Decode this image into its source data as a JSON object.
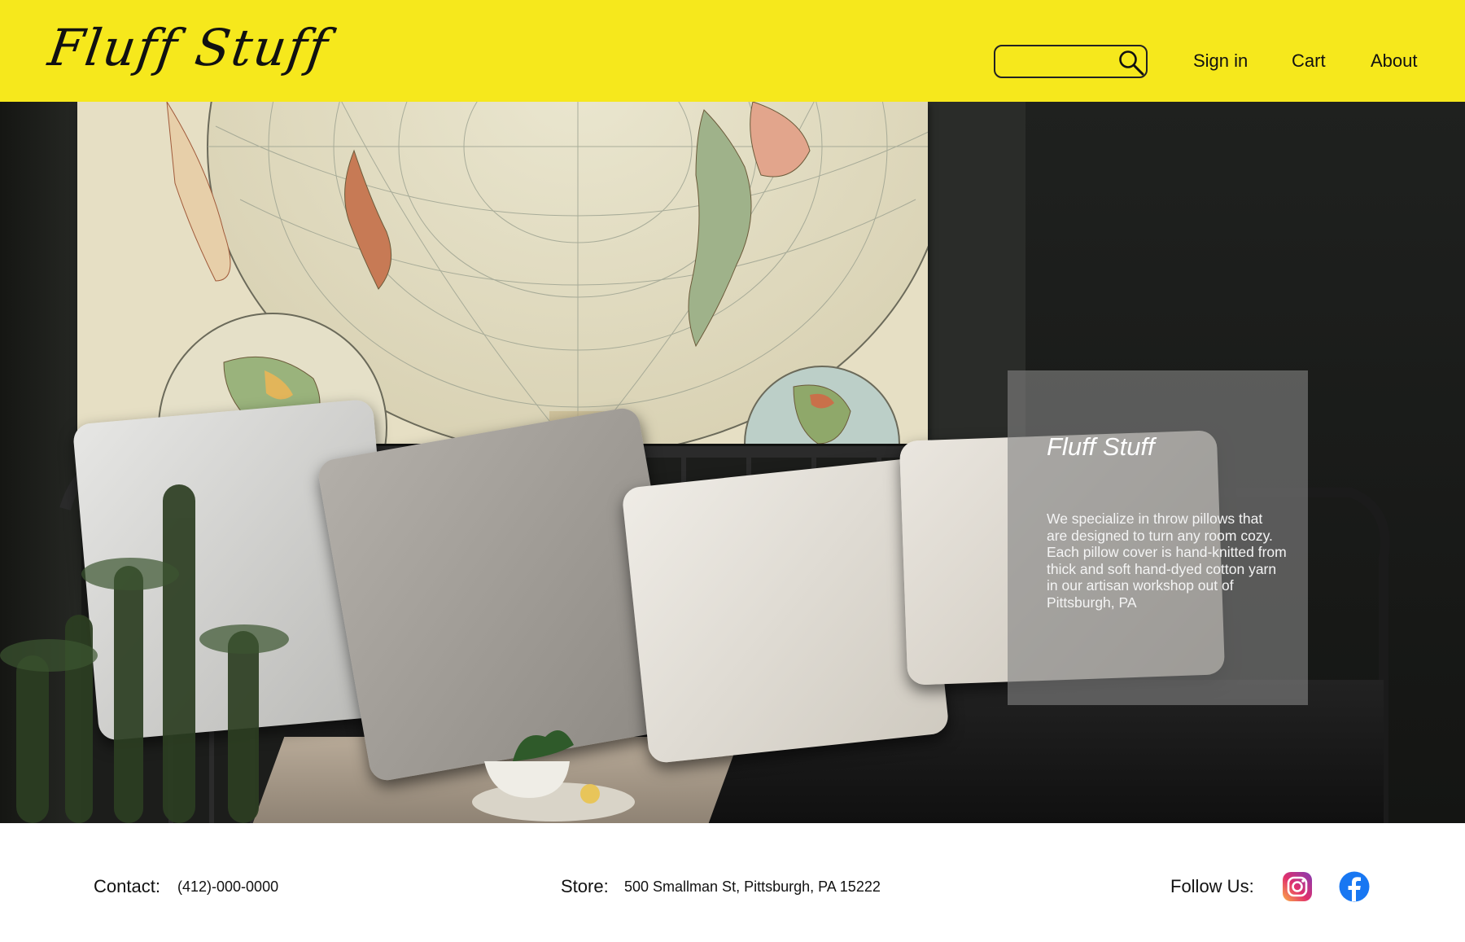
{
  "header": {
    "logo": "Fluff Stuff",
    "search": {
      "value": "",
      "placeholder": "",
      "icon": "search-icon"
    },
    "nav": {
      "sign_in": "Sign in",
      "cart": "Cart",
      "about": "About"
    },
    "background_color": "#f6e81c"
  },
  "hero": {
    "info": {
      "title": "Fluff Stuff",
      "text": "We specialize in throw pillows that are designed to turn any room cozy. Each pillow cover is hand-knitted from thick and soft hand-dyed cotton yarn in our artisan workshop out of Pittsburgh, PA"
    }
  },
  "footer": {
    "contact_label": "Contact:",
    "contact_value": "(412)-000-0000",
    "store_label": "Store:",
    "store_value": "500 Smallman St, Pittsburgh, PA 15222",
    "follow_label": "Follow Us:",
    "social": [
      {
        "icon": "instagram-icon"
      },
      {
        "icon": "facebook-icon"
      }
    ]
  }
}
